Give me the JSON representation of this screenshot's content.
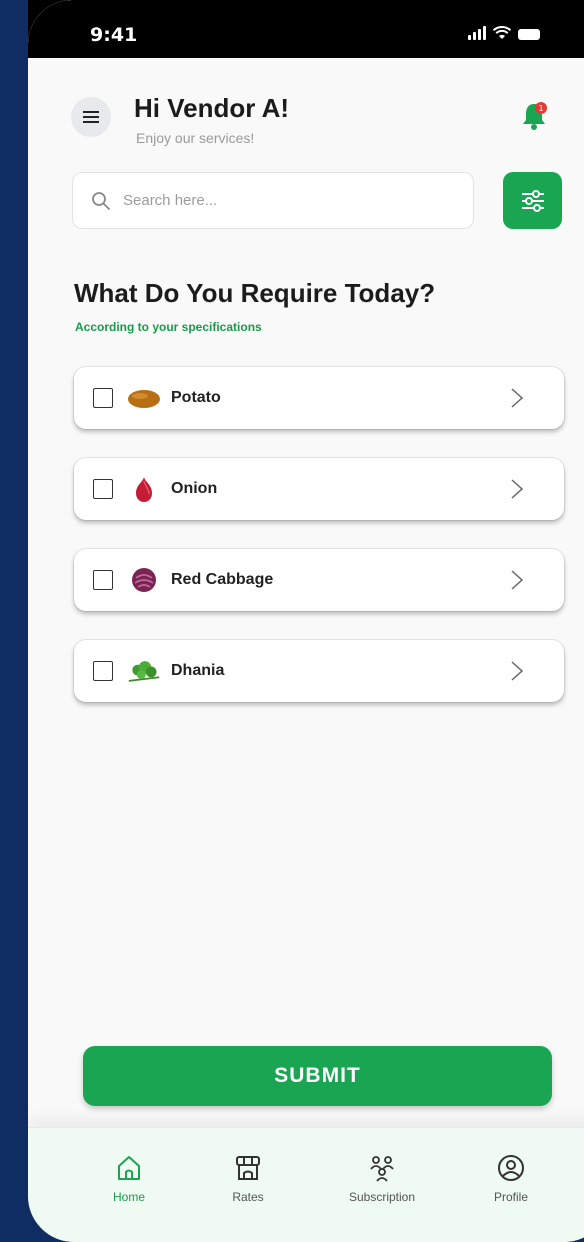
{
  "status_bar": {
    "time": "9:41"
  },
  "header": {
    "greeting": "Hi Vendor A!",
    "subtitle": "Enjoy our services!"
  },
  "search": {
    "placeholder": "Search here..."
  },
  "section": {
    "title": "What Do You Require Today?",
    "subtitle": "According to your specifications"
  },
  "items": [
    {
      "label": "Potato",
      "icon": "potato-icon",
      "checked": false
    },
    {
      "label": "Onion",
      "icon": "onion-icon",
      "checked": false
    },
    {
      "label": "Red Cabbage",
      "icon": "red-cabbage-icon",
      "checked": false
    },
    {
      "label": "Dhania",
      "icon": "dhania-icon",
      "checked": false
    }
  ],
  "submit_label": "SUBMIT",
  "nav": [
    {
      "label": "Home",
      "icon": "home-icon",
      "active": true
    },
    {
      "label": "Rates",
      "icon": "store-icon",
      "active": false
    },
    {
      "label": "Subscription",
      "icon": "group-icon",
      "active": false
    },
    {
      "label": "Profile",
      "icon": "profile-icon",
      "active": false
    }
  ],
  "colors": {
    "accent": "#1aa552",
    "background": "#0f2c63",
    "notification": "#e53935"
  }
}
